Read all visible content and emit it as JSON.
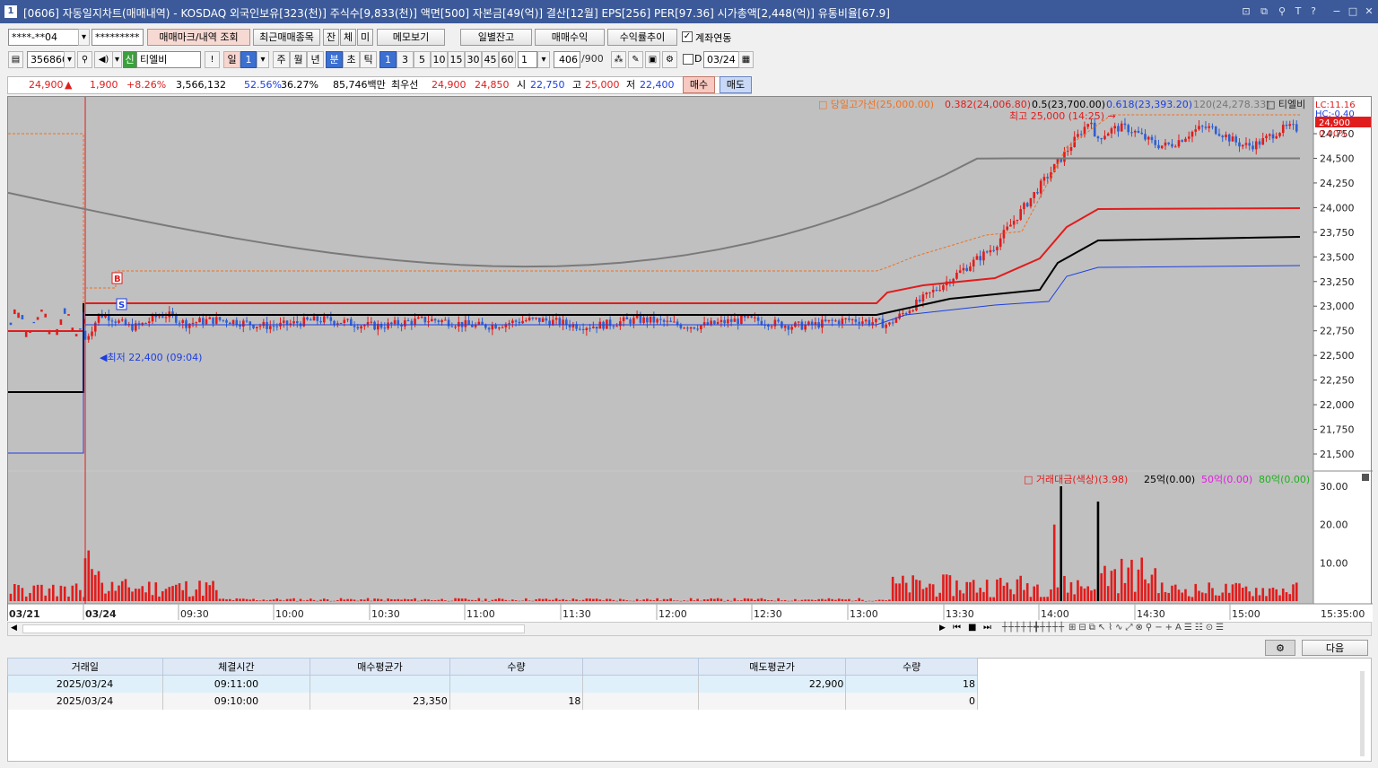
{
  "window": {
    "number": "1",
    "title": "[0606] 자동일지차트(매매내역) - KOSDAQ 외국인보유[323(천)] 주식수[9,833(천)] 액면[500] 자본금[49(억)] 결산[12월] EPS[256] PER[97.36] 시가총액[2,448(억)] 유통비율[67.9]"
  },
  "toolbar1": {
    "account": "****-**04",
    "password": "*********",
    "trade_mark_btn": "매매마크/내역 조회",
    "recent_btn": "최근매매종목",
    "btn_jan": "잔",
    "btn_che": "체",
    "btn_mi": "미",
    "memo_btn": "메모보기",
    "daily_balance_btn": "일별잔고",
    "trade_profit_btn": "매매수익",
    "profit_trend_btn": "수익률추이",
    "account_link_label": "계좌연동",
    "account_link_checked": true
  },
  "toolbar2": {
    "code": "356860",
    "sin": "신",
    "stock_name": "티엘비",
    "exclaim": "!",
    "il": "일",
    "il_num": "1",
    "ju": "주",
    "wol": "월",
    "nyeon": "년",
    "bun": "분",
    "cho": "초",
    "tick": "틱",
    "intervals": [
      "1",
      "3",
      "5",
      "10",
      "15",
      "30",
      "45",
      "60"
    ],
    "selected_interval": "1",
    "count_select": "1",
    "count": "406",
    "total": "/900",
    "d_label": "D",
    "date": "03/24"
  },
  "price_bar": {
    "price": "24,900",
    "arrow": "▲",
    "change": "1,900",
    "pct": "+8.26%",
    "volume": "3,566,132",
    "r1": "52.56%",
    "r2": "36.27%",
    "amount": "85,746백만",
    "best_label": "최우선",
    "best_ask": "24,900",
    "best_bid": "24,850",
    "open_label": "시",
    "open": "22,750",
    "high_label": "고",
    "high": "25,000",
    "low_label": "저",
    "low": "22,400",
    "buy_btn": "매수",
    "sell_btn": "매도"
  },
  "chart": {
    "legend_main": {
      "l1": "당일고가선(25,000.00)",
      "l2": "0.382(24,006.80)",
      "l3": "0.5(23,700.00)",
      "l4": "0.618(23,393.20)",
      "l5": "120(24,278.33)",
      "name": "티엘비"
    },
    "lc": "LC:11.16",
    "hc": "HC:-0.40",
    "price_tag": "24,900",
    "pct_tag": "0.00%",
    "high_annotation": "최고 25,000 (14:25)",
    "low_annotation": "최저 22,400 (09:04)",
    "buy_mark": "B",
    "sell_mark": "S",
    "price_axis": [
      "24,750",
      "24,500",
      "24,250",
      "24,000",
      "23,750",
      "23,500",
      "23,250",
      "23,000",
      "22,750",
      "22,500",
      "22,250",
      "22,000",
      "21,750",
      "21,500"
    ],
    "vol_legend": {
      "l1": "거래대금(색상)(3.98)",
      "l2": "25억(0.00)",
      "l3": "50억(0.00)",
      "l4": "80억(0.00)"
    },
    "vol_axis": [
      "30.00",
      "20.00",
      "10.00"
    ],
    "time_axis": [
      "03/21",
      "03/24",
      "09:30",
      "10:00",
      "10:30",
      "11:00",
      "11:30",
      "12:00",
      "12:30",
      "13:00",
      "13:30",
      "14:00",
      "14:30",
      "15:00"
    ],
    "time_end": "15:35:00"
  },
  "next_btn": "다음",
  "table": {
    "headers": [
      "거래일",
      "체결시간",
      "매수평균가",
      "수량",
      "",
      "매도평균가",
      "수량"
    ],
    "rows": [
      [
        "2025/03/24",
        "09:11:00",
        "",
        "",
        "",
        "22,900",
        "18"
      ],
      [
        "2025/03/24",
        "09:10:00",
        "23,350",
        "18",
        "",
        "",
        "0"
      ]
    ]
  },
  "colors": {
    "up": "#e11c1c",
    "down": "#2f5fd0",
    "title_bar": "#3c5a99",
    "chart_bg": "#c0c0c0"
  }
}
